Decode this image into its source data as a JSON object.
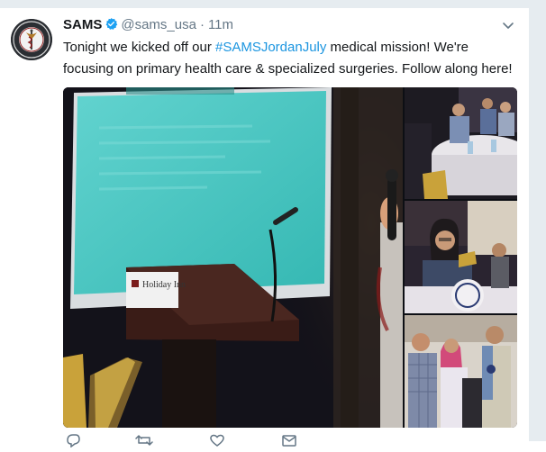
{
  "tweet": {
    "author_name": "SAMS",
    "handle": "@sams_usa",
    "separator": "·",
    "time": "11m",
    "text_part1": "Tonight we kicked off our ",
    "hashtag": "#SAMSJordanJuly",
    "text_part2": " medical mission! We're focusing on primary health care & specialized surgeries. Follow along here!"
  },
  "media": {
    "podium_brand": "Holiday Inn"
  },
  "colors": {
    "link": "#1b95e0",
    "verified": "#1da1f2",
    "muted": "#657786",
    "slide": "#3ec6c1"
  },
  "icons": [
    "verified-badge-icon",
    "chevron-down-icon",
    "reply-icon",
    "retweet-icon",
    "like-icon",
    "direct-message-icon"
  ]
}
